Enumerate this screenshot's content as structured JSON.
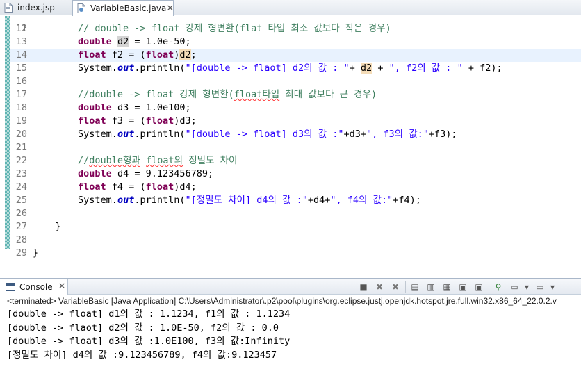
{
  "editor_tabs": [
    {
      "label": "index.jsp",
      "active": false
    },
    {
      "label": "VariableBasic.java",
      "active": true
    }
  ],
  "editor": {
    "first_partial_line_number": "11",
    "lines": [
      {
        "number": "12",
        "current": false,
        "segments": [
          {
            "t": "ind",
            "text": "        "
          },
          {
            "t": "cm",
            "text": "// double -> float 강제 형변환(flat 타입 최소 값보다 작은 경우)"
          }
        ]
      },
      {
        "number": "13",
        "current": false,
        "segments": [
          {
            "t": "ind",
            "text": "        "
          },
          {
            "t": "kw",
            "text": "double"
          },
          {
            "t": "plain",
            "text": " "
          },
          {
            "t": "occ-w",
            "text": "d2"
          },
          {
            "t": "plain",
            "text": " = 1.0e-50;"
          }
        ]
      },
      {
        "number": "14",
        "current": true,
        "segments": [
          {
            "t": "ind",
            "text": "        "
          },
          {
            "t": "kw",
            "text": "float"
          },
          {
            "t": "plain",
            "text": " f2 = ("
          },
          {
            "t": "kw",
            "text": "float"
          },
          {
            "t": "plain",
            "text": ")"
          },
          {
            "t": "occ-r",
            "text": "d2"
          },
          {
            "t": "plain",
            "text": ";"
          }
        ]
      },
      {
        "number": "15",
        "current": false,
        "segments": [
          {
            "t": "ind",
            "text": "        "
          },
          {
            "t": "plain",
            "text": "System."
          },
          {
            "t": "fld",
            "text": "out"
          },
          {
            "t": "plain",
            "text": ".println("
          },
          {
            "t": "str",
            "text": "\"[double -> flaot] d2의 값 : \""
          },
          {
            "t": "plain",
            "text": "+ "
          },
          {
            "t": "occ-r",
            "text": "d2"
          },
          {
            "t": "plain",
            "text": " + "
          },
          {
            "t": "str",
            "text": "\", f2의 값 : \""
          },
          {
            "t": "plain",
            "text": " + f2);"
          }
        ]
      },
      {
        "number": "16",
        "current": false,
        "segments": []
      },
      {
        "number": "17",
        "current": false,
        "segments": [
          {
            "t": "ind",
            "text": "        "
          },
          {
            "t": "cm",
            "text": "//double -> float 강제 형변환("
          },
          {
            "t": "cm squig",
            "text": "float타입"
          },
          {
            "t": "cm",
            "text": " 최대 값보다 큰 경우)"
          }
        ]
      },
      {
        "number": "18",
        "current": false,
        "segments": [
          {
            "t": "ind",
            "text": "        "
          },
          {
            "t": "kw",
            "text": "double"
          },
          {
            "t": "plain",
            "text": " d3 = 1.0e100;"
          }
        ]
      },
      {
        "number": "19",
        "current": false,
        "segments": [
          {
            "t": "ind",
            "text": "        "
          },
          {
            "t": "kw",
            "text": "float"
          },
          {
            "t": "plain",
            "text": " f3 = ("
          },
          {
            "t": "kw",
            "text": "float"
          },
          {
            "t": "plain",
            "text": ")d3;"
          }
        ]
      },
      {
        "number": "20",
        "current": false,
        "segments": [
          {
            "t": "ind",
            "text": "        "
          },
          {
            "t": "plain",
            "text": "System."
          },
          {
            "t": "fld",
            "text": "out"
          },
          {
            "t": "plain",
            "text": ".println("
          },
          {
            "t": "str",
            "text": "\"[double -> float] d3의 값 :\""
          },
          {
            "t": "plain",
            "text": "+d3+"
          },
          {
            "t": "str",
            "text": "\", f3의 값:\""
          },
          {
            "t": "plain",
            "text": "+f3);"
          }
        ]
      },
      {
        "number": "21",
        "current": false,
        "segments": []
      },
      {
        "number": "22",
        "current": false,
        "segments": [
          {
            "t": "ind",
            "text": "        "
          },
          {
            "t": "cm",
            "text": "//"
          },
          {
            "t": "cm squig",
            "text": "double형과"
          },
          {
            "t": "cm",
            "text": " "
          },
          {
            "t": "cm squig",
            "text": "float의"
          },
          {
            "t": "cm",
            "text": " 정밀도 차이"
          }
        ]
      },
      {
        "number": "23",
        "current": false,
        "segments": [
          {
            "t": "ind",
            "text": "        "
          },
          {
            "t": "kw",
            "text": "double"
          },
          {
            "t": "plain",
            "text": " d4 = 9.123456789;"
          }
        ]
      },
      {
        "number": "24",
        "current": false,
        "segments": [
          {
            "t": "ind",
            "text": "        "
          },
          {
            "t": "kw",
            "text": "float"
          },
          {
            "t": "plain",
            "text": " f4 = ("
          },
          {
            "t": "kw",
            "text": "float"
          },
          {
            "t": "plain",
            "text": ")d4;"
          }
        ]
      },
      {
        "number": "25",
        "current": false,
        "segments": [
          {
            "t": "ind",
            "text": "        "
          },
          {
            "t": "plain",
            "text": "System."
          },
          {
            "t": "fld",
            "text": "out"
          },
          {
            "t": "plain",
            "text": ".println("
          },
          {
            "t": "str",
            "text": "\"[정밀도 차이] d4의 값 :\""
          },
          {
            "t": "plain",
            "text": "+d4+"
          },
          {
            "t": "str",
            "text": "\", f4의 값:\""
          },
          {
            "t": "plain",
            "text": "+f4);"
          }
        ]
      },
      {
        "number": "26",
        "current": false,
        "segments": []
      },
      {
        "number": "27",
        "current": false,
        "segments": [
          {
            "t": "ind",
            "text": "    "
          },
          {
            "t": "plain",
            "text": "}"
          }
        ]
      },
      {
        "number": "28",
        "current": false,
        "segments": []
      },
      {
        "number": "29",
        "current": false,
        "segments": [
          {
            "t": "plain",
            "text": "}"
          }
        ]
      }
    ]
  },
  "console": {
    "tab_label": "Console",
    "status": "<terminated> VariableBasic [Java Application] C:\\Users\\Administrator\\.p2\\pool\\plugins\\org.eclipse.justj.openjdk.hotspot.jre.full.win32.x86_64_22.0.2.v",
    "output": [
      "[double -> float] d1의 값 : 1.1234, f1의 값 : 1.1234",
      "[double -> flaot] d2의 값 : 1.0E-50, f2의 값 : 0.0",
      "[double -> float] d3의 값 :1.0E100, f3의 값:Infinity",
      "[정밀도 차이] d4의 값 :9.123456789, f4의 값:9.123457"
    ],
    "toolbar": [
      {
        "name": "terminate-icon",
        "glyph": "■"
      },
      {
        "name": "remove-launch-icon",
        "glyph": "✖"
      },
      {
        "name": "remove-all-terminated-icon",
        "glyph": "✖"
      },
      {
        "name": "sep"
      },
      {
        "name": "clear-console-icon",
        "glyph": "▤"
      },
      {
        "name": "scroll-lock-icon",
        "glyph": "▥"
      },
      {
        "name": "word-wrap-icon",
        "glyph": "▦"
      },
      {
        "name": "show-on-stdout-icon",
        "glyph": "▣"
      },
      {
        "name": "show-on-stderr-icon",
        "glyph": "▣"
      },
      {
        "name": "sep"
      },
      {
        "name": "pin-console-icon",
        "glyph": "⚲"
      },
      {
        "name": "display-console-icon",
        "glyph": "▭"
      },
      {
        "name": "display-console-dropdown-icon",
        "glyph": "▾"
      },
      {
        "name": "open-console-icon",
        "glyph": "▭"
      },
      {
        "name": "open-console-dropdown-icon",
        "glyph": "▾"
      }
    ],
    "close_glyph": "✕"
  },
  "icons": {
    "tab_close": "✕",
    "scroll_left": "◀",
    "scroll_right": "▶"
  }
}
